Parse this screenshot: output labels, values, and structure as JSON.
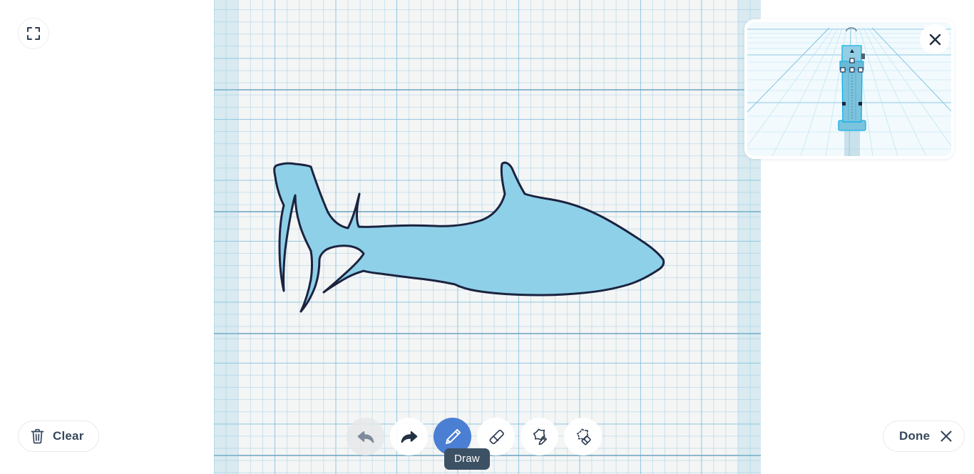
{
  "app": {
    "mode": "sketch-draw",
    "accent_color": "#4a7fd4",
    "ink_color": "#1b2340",
    "fill_color": "#8ed0e8"
  },
  "canvas": {
    "name": "sketch-grid-canvas",
    "background_color": "#f4f5f5",
    "grid_line_color": "#68b4d8",
    "guide_band_color": "#8ccbe4",
    "drawing": {
      "name": "shark-silhouette",
      "fill": "#8ed0e8",
      "stroke": "#1b2340",
      "stroke_width": 3
    }
  },
  "fullscreen_button": {
    "icon": "fullscreen-expand-icon",
    "title": "Fullscreen"
  },
  "clear_button": {
    "label": "Clear",
    "icon": "trash-icon"
  },
  "done_button": {
    "label": "Done",
    "icon": "close-x-icon"
  },
  "tooltip": {
    "text": "Draw",
    "for_tool": "draw"
  },
  "toolbar": {
    "tools": [
      {
        "id": "undo",
        "label": "Undo",
        "icon": "undo-arrow-icon",
        "state": "disabled"
      },
      {
        "id": "redo",
        "label": "Redo",
        "icon": "redo-arrow-icon",
        "state": "enabled"
      },
      {
        "id": "draw",
        "label": "Draw",
        "icon": "pencil-icon",
        "state": "active"
      },
      {
        "id": "erase",
        "label": "Erase",
        "icon": "eraser-icon",
        "state": "enabled"
      },
      {
        "id": "shape-draw",
        "label": "Shape Draw",
        "icon": "star-pencil-icon",
        "state": "enabled"
      },
      {
        "id": "shape-erase",
        "label": "Shape Erase",
        "icon": "star-dashed-eraser-icon",
        "state": "enabled"
      }
    ]
  },
  "preview_panel": {
    "name": "3d-workplane-preview",
    "close_icon": "close-x-icon",
    "background_color": "#eef7fb",
    "object": {
      "name": "extruded-sketch-object",
      "fill": "#7cc3dd",
      "outline": "#16b3e8",
      "handle_fill": "#ffffff",
      "handle_stroke": "#1b2340"
    }
  }
}
